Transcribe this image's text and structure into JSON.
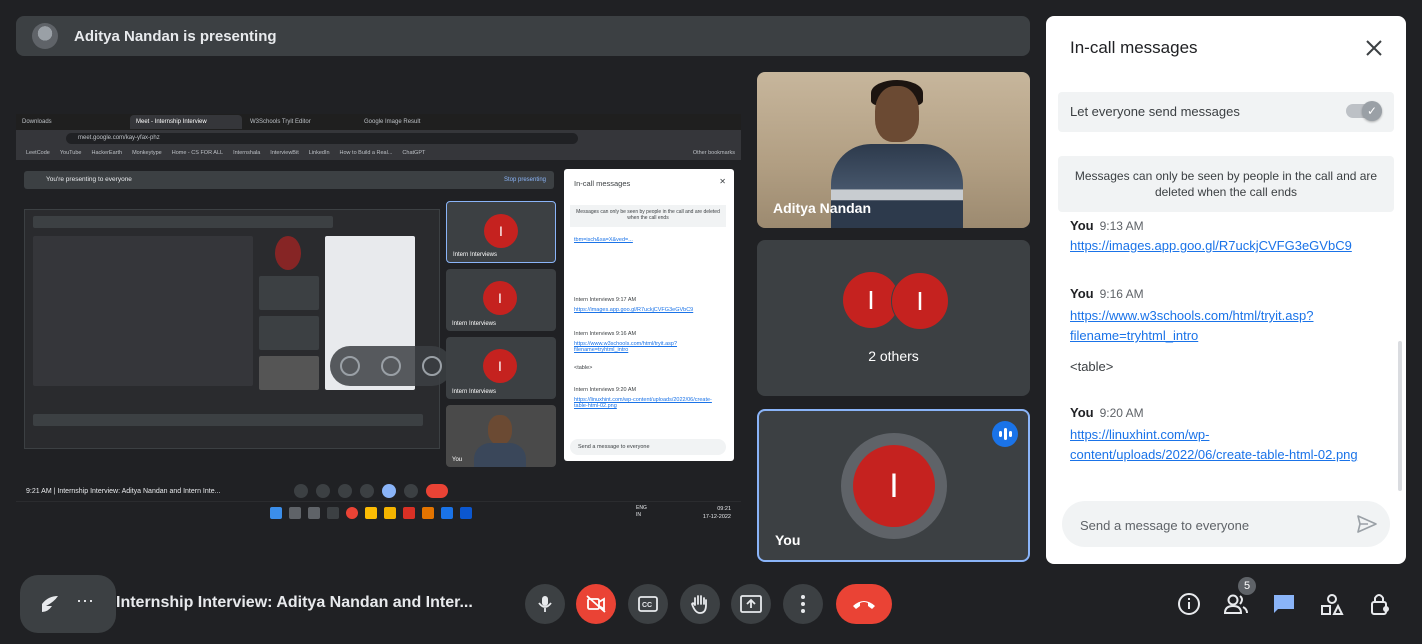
{
  "banner": {
    "text": "Aditya Nandan is presenting"
  },
  "shared_screen": {
    "browser_tabs": [
      "Downloads",
      "Meet - Internship Interview",
      "W3Schools Tryit Editor",
      "Google Image Result"
    ],
    "url": "meet.google.com/kay-yfax-phz",
    "bookmarks": [
      "LeetCode",
      "YouTube",
      "HackerEarth",
      "Monkeytype",
      "Home - CS FOR ALL",
      "Internshala",
      "InterviewBit",
      "LinkedIn",
      "How to Build a Real...",
      "ChatGPT",
      "Other bookmarks"
    ],
    "presenting_text": "You're presenting to everyone",
    "stop_presenting": "Stop presenting",
    "tile_label": "Intern Interviews",
    "self_label": "You",
    "chat_title": "In-call messages",
    "chat_note": "Messages can only be seen by people in the call and are deleted when the call ends",
    "chat_lines": [
      {
        "who": "Intern Interviews",
        "time": "9:17 AM",
        "link": "https://images.app.goo.gl/R7uckjCVFG3eGVbC9"
      },
      {
        "who": "Intern Interviews",
        "time": "9:16 AM",
        "link": "https://www.w3schools.com/html/tryit.asp?filename=tryhtml_intro"
      },
      {
        "who": "Intern Interviews",
        "time": "9:20 AM",
        "link": "https://linuxhint.com/wp-content/uploads/2022/06/create-table-html-02.png"
      }
    ],
    "chat_table_text": "<table>",
    "chat_input": "Send a message to everyone",
    "bottom_text": "9:21 AM  |  Internship Interview: Aditya Nandan and Intern Inte...",
    "taskbar_lang": "ENG\nIN",
    "taskbar_time": "09:21\n17-12-2022"
  },
  "tiles": {
    "aditya": {
      "name": "Aditya Nandan"
    },
    "others": {
      "initial": "I",
      "caption": "2 others"
    },
    "you": {
      "initial": "I",
      "name": "You"
    }
  },
  "chat": {
    "title": "In-call messages",
    "toggle_label": "Let everyone send messages",
    "toggle_on": true,
    "note": "Messages can only be seen by people in the call and are deleted when the call ends",
    "messages": [
      {
        "sender": "You",
        "time": "9:13 AM",
        "links": [
          "https://images.app.goo.gl/R7uckjCVFG3eGVbC9"
        ]
      },
      {
        "sender": "You",
        "time": "9:16 AM",
        "links": [
          "https://www.w3schools.com/html/tryit.asp?",
          "filename=tryhtml_intro"
        ],
        "text": "<table>"
      },
      {
        "sender": "You",
        "time": "9:20 AM",
        "links": [
          "https://linuxhint.com/wp-",
          "content/uploads/2022/06/create-table-html-02.png"
        ]
      }
    ],
    "input_placeholder": "Send a message to everyone"
  },
  "bottom": {
    "meeting_title": "Internship Interview: Aditya Nandan and Inter...",
    "more_dots": "⋯",
    "people_count": "5"
  },
  "colors": {
    "hangup": "#ea4335",
    "accent": "#1a73e8",
    "avatar_red": "#c5221f"
  }
}
